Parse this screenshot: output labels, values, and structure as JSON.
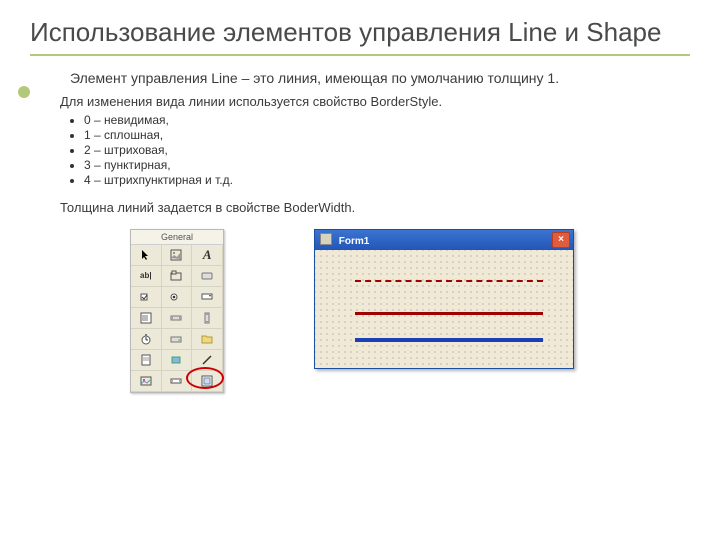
{
  "title": "Использование элементов управления Line и Shape",
  "lead": "Элемент управления Line – это линия, имеющая по умолчанию толщину 1.",
  "sub": "Для изменения вида  линии используется свойство BorderStyle.",
  "bullets": [
    "0 – невидимая,",
    "1 – сплошная,",
    "2 – штриховая,",
    "3 – пунктирная,",
    "4 – штрихпунктирная и т.д."
  ],
  "footer": "Толщина линий задается в свойстве BoderWidth.",
  "toolbox": {
    "header": "General"
  },
  "formWindow": {
    "title": "Form1",
    "close": "×"
  }
}
